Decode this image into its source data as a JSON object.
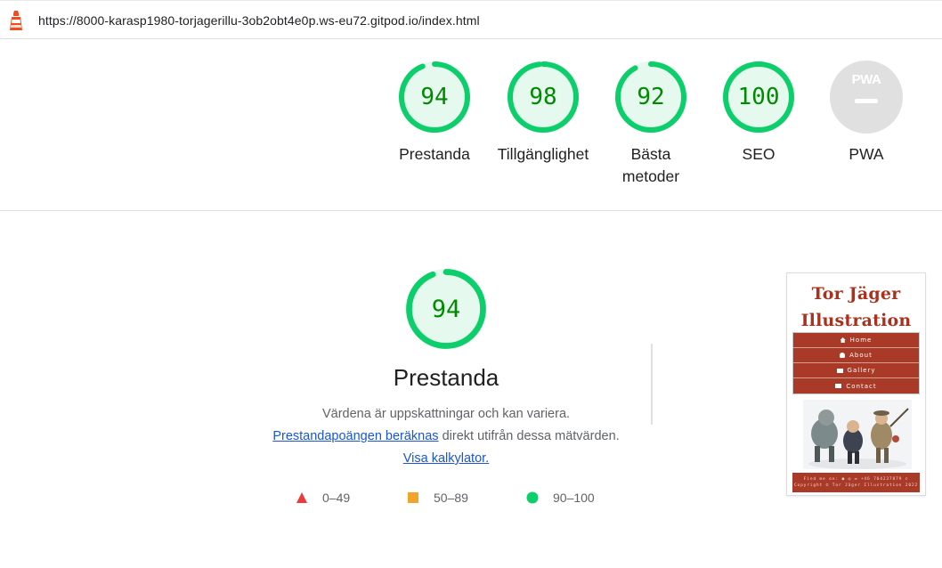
{
  "url_bar": {
    "url": "https://8000-karasp1980-torjagerillu-3ob2obt4e0p.ws-eu72.gitpod.io/index.html",
    "logo_icon": "lighthouse-icon"
  },
  "scores": [
    {
      "value": "94",
      "score": 94,
      "label": "Prestanda"
    },
    {
      "value": "98",
      "score": 98,
      "label": "Tillgänglighet"
    },
    {
      "value": "92",
      "score": 92,
      "label": "Bästa metoder"
    },
    {
      "value": "100",
      "score": 100,
      "label": "SEO"
    },
    {
      "logo_text": "PWA",
      "label": "PWA"
    }
  ],
  "main": {
    "score": "94",
    "score_value": 94,
    "title": "Prestanda",
    "desc_line1": "Värdena är uppskattningar och kan variera.",
    "desc_link1": "Prestandapoängen beräknas",
    "desc_mid": " direkt utifrån dessa mätvärden. ",
    "desc_link2": "Visa kalkylator."
  },
  "legend": [
    {
      "range": "0–49",
      "shape": "triangle",
      "color": "#eb3b3b"
    },
    {
      "range": "50–89",
      "shape": "square",
      "color": "#f2a429"
    },
    {
      "range": "90–100",
      "shape": "circle",
      "color": "#0cce6b"
    }
  ],
  "colors": {
    "pass": "#0cce6b",
    "pass_fill": "#e6f9ee",
    "pass_text": "#008a00",
    "site_red": "#a93a28"
  },
  "screenshot": {
    "title_line1": "Tor Jäger",
    "title_line2": "Illustration",
    "nav": [
      {
        "label": "Home",
        "icon": "home-icon"
      },
      {
        "label": "About",
        "icon": "user-icon"
      },
      {
        "label": "Gallery",
        "icon": "image-icon"
      },
      {
        "label": "Contact",
        "icon": "mail-icon"
      }
    ],
    "footer_line1": "Find me on:  ● ◎ ✉  +46 704237879 ✆",
    "footer_line2": "Copyright © Tor Jäger Illustration 2022"
  }
}
